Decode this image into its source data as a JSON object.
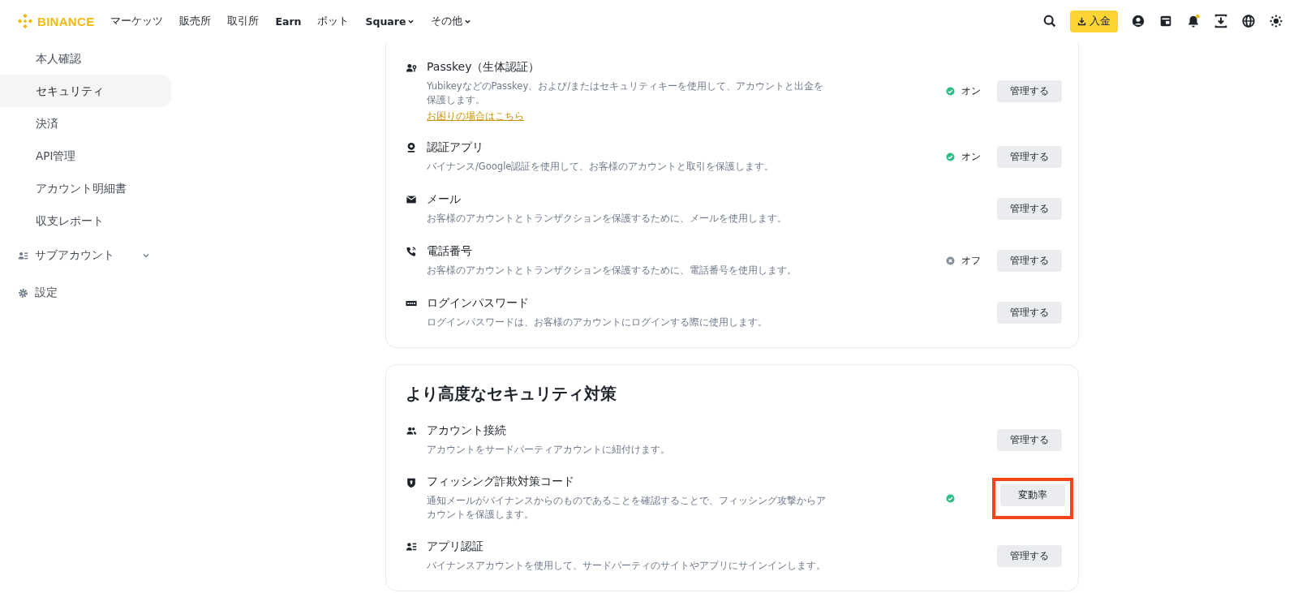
{
  "header": {
    "logo": "BINANCE",
    "nav": [
      {
        "label": "マーケッツ",
        "bold": false,
        "dropdown": false
      },
      {
        "label": "販売所",
        "bold": false,
        "dropdown": false
      },
      {
        "label": "取引所",
        "bold": false,
        "dropdown": false
      },
      {
        "label": "Earn",
        "bold": true,
        "dropdown": false
      },
      {
        "label": "ボット",
        "bold": false,
        "dropdown": false
      },
      {
        "label": "Square",
        "bold": true,
        "dropdown": true
      },
      {
        "label": "その他",
        "bold": false,
        "dropdown": true
      }
    ],
    "deposit_button": "入金",
    "notification_dot": true
  },
  "sidebar": {
    "items": [
      {
        "label": "本人確認",
        "selected": false
      },
      {
        "label": "セキュリティ",
        "selected": true
      },
      {
        "label": "決済",
        "selected": false
      },
      {
        "label": "API管理",
        "selected": false
      },
      {
        "label": "アカウント明細書",
        "selected": false
      },
      {
        "label": "収支レポート",
        "selected": false
      }
    ],
    "groups": [
      {
        "label": "サブアカウント",
        "kind": "users",
        "expandable": true
      },
      {
        "label": "設定",
        "kind": "gear",
        "expandable": false
      }
    ]
  },
  "sections": [
    {
      "items": [
        {
          "kind": "passkey",
          "title": "Passkey（生体認証）",
          "description": "YubikeyなどのPasskey、および/またはセキュリティキーを使用して、アカウントと出金を保護します。",
          "link": "お困りの場合はこちら",
          "status": {
            "kind": "on",
            "label": "オン"
          },
          "button": "管理する",
          "highlighted": false
        },
        {
          "kind": "authenticator",
          "title": "認証アプリ",
          "description": "バイナンス/Google認証を使用して、お客様のアカウントと取引を保護します。",
          "status": {
            "kind": "on",
            "label": "オン"
          },
          "button": "管理する",
          "highlighted": false
        },
        {
          "kind": "mail",
          "title": "メール",
          "description": "お客様のアカウントとトランザクションを保護するために、メールを使用します。",
          "button": "管理する",
          "highlighted": false
        },
        {
          "kind": "phone",
          "title": "電話番号",
          "description": "お客様のアカウントとトランザクションを保護するために、電話番号を使用します。",
          "status": {
            "kind": "off",
            "label": "オフ"
          },
          "button": "管理する",
          "highlighted": false
        },
        {
          "kind": "password",
          "title": "ログインパスワード",
          "description": "ログインパスワードは、お客様のアカウントにログインする際に使用します。",
          "button": "管理する",
          "highlighted": false
        }
      ]
    },
    {
      "title": "より高度なセキュリティ対策",
      "items": [
        {
          "kind": "people",
          "title": "アカウント接続",
          "description": "アカウントをサードパーティアカウントに紐付けます。",
          "button": "管理する",
          "highlighted": false
        },
        {
          "kind": "shield",
          "title": "フィッシング詐欺対策コード",
          "description": "通知メールがバイナンスからのものであることを確認することで、フィッシング攻撃からアカウントを保護します。",
          "status": {
            "kind": "on"
          },
          "button": "変動率",
          "highlighted": true
        },
        {
          "kind": "idcard",
          "title": "アプリ認証",
          "description": "バイナンスアカウントを使用して、サードパーティのサイトやアプリにサインインします。",
          "button": "管理する",
          "highlighted": false
        }
      ]
    }
  ]
}
